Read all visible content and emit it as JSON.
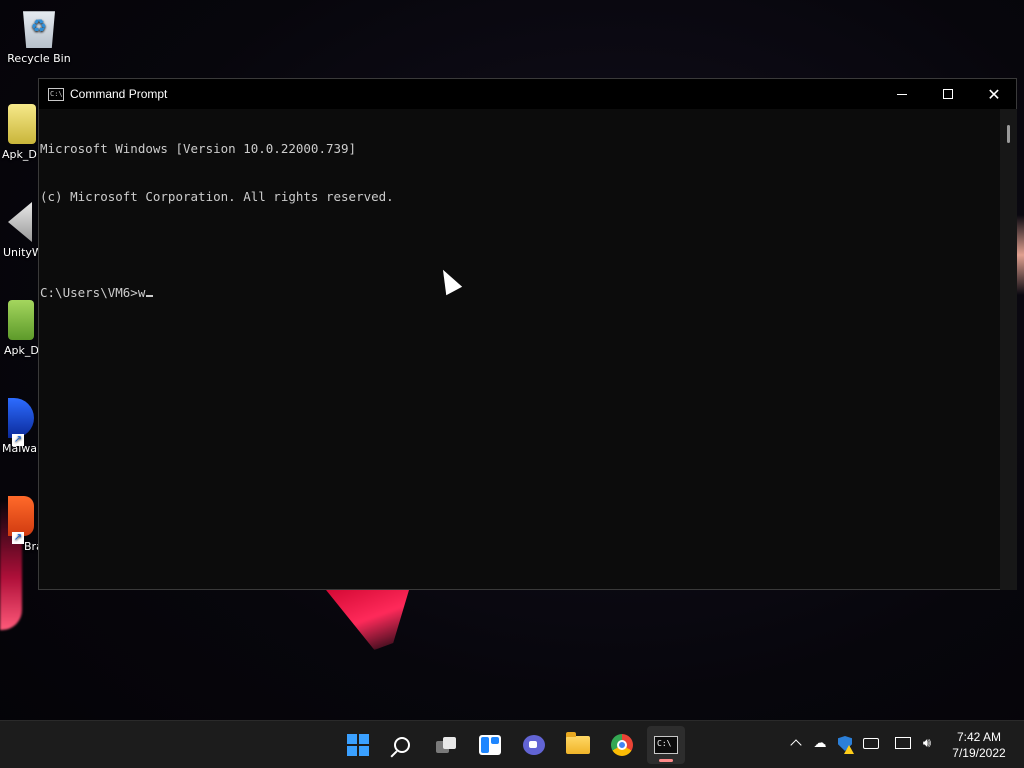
{
  "desktop": {
    "icons": [
      {
        "label": "Recycle Bin"
      },
      {
        "label": "Apk_D"
      },
      {
        "label": "UnityW"
      },
      {
        "label": "Apk_D"
      },
      {
        "label": "Malwa"
      },
      {
        "label": "Bra"
      }
    ]
  },
  "window": {
    "title": "Command Prompt",
    "close_glyph": "✕"
  },
  "console": {
    "lines": [
      "Microsoft Windows [Version 10.0.22000.739]",
      "(c) Microsoft Corporation. All rights reserved.",
      "",
      "C:\\Users\\VM6>w"
    ]
  },
  "taskbar": {
    "apps": [
      {
        "name": "start",
        "icon": "windows-start-icon"
      },
      {
        "name": "search",
        "icon": "search-icon"
      },
      {
        "name": "task-view",
        "icon": "task-view-icon"
      },
      {
        "name": "widgets",
        "icon": "widgets-icon"
      },
      {
        "name": "chat",
        "icon": "chat-icon"
      },
      {
        "name": "file-explorer",
        "icon": "folder-icon"
      },
      {
        "name": "chrome",
        "icon": "chrome-icon"
      },
      {
        "name": "command-prompt",
        "icon": "cmd-icon",
        "active": true
      }
    ],
    "tray": {
      "time": "7:42 AM",
      "date": "7/19/2022"
    }
  },
  "colors": {
    "console_bg": "#0c0c0c",
    "console_fg": "#cccccc",
    "taskbar_bg": "#1c1c1c",
    "active_indicator": "#ff8a8a"
  }
}
